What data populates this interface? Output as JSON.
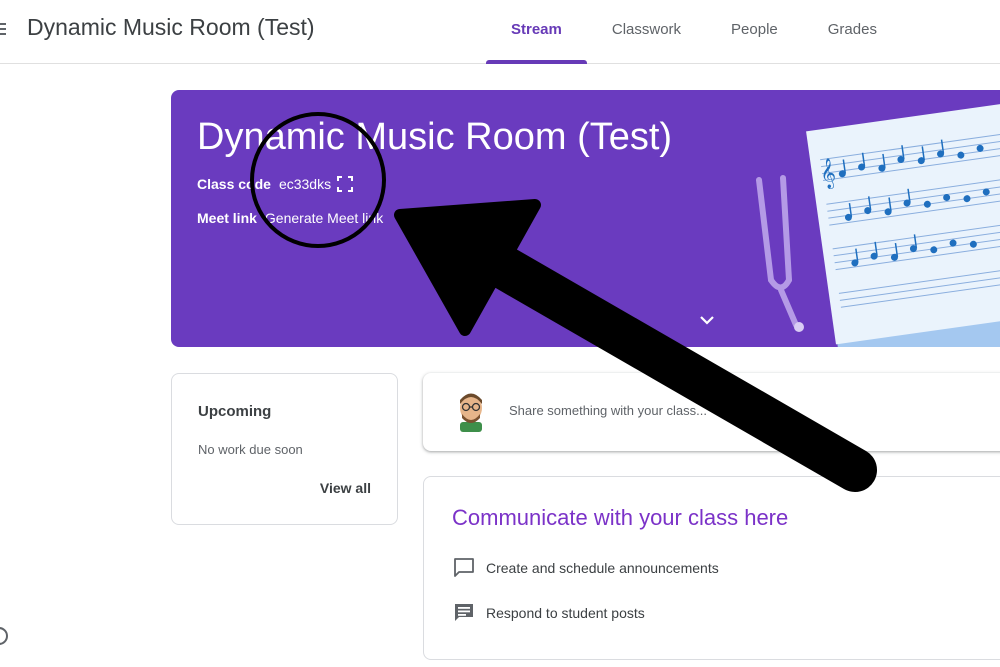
{
  "header": {
    "title": "Dynamic Music Room (Test)",
    "tabs": [
      {
        "label": "Stream",
        "active": true
      },
      {
        "label": "Classwork",
        "active": false
      },
      {
        "label": "People",
        "active": false
      },
      {
        "label": "Grades",
        "active": false
      }
    ]
  },
  "banner": {
    "title": "Dynamic Music Room (Test)",
    "class_code_label": "Class code",
    "class_code_value": "ec33dks",
    "meet_link_label": "Meet link",
    "meet_link_value": "Generate Meet link",
    "color": "#6a3bbf"
  },
  "upcoming": {
    "title": "Upcoming",
    "subtitle": "No work due soon",
    "view_all_label": "View all"
  },
  "share": {
    "placeholder": "Share something with your class..."
  },
  "communicate": {
    "title": "Communicate with your class here",
    "items": [
      {
        "icon": "announcement-icon",
        "label": "Create and schedule announcements"
      },
      {
        "icon": "student-posts-icon",
        "label": "Respond to student posts"
      }
    ]
  },
  "colors": {
    "accent": "#673ab7",
    "communicate_title": "#7b32c8"
  },
  "icons": [
    "menu-icon",
    "expand-icon",
    "chevron-down-icon",
    "avatar",
    "announcement-icon",
    "student-posts-icon"
  ]
}
